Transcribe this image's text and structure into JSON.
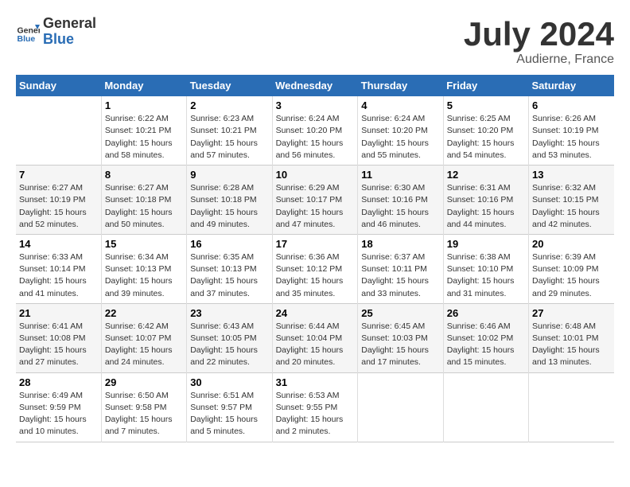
{
  "logo": {
    "text_general": "General",
    "text_blue": "Blue"
  },
  "title": "July 2024",
  "subtitle": "Audierne, France",
  "days_of_week": [
    "Sunday",
    "Monday",
    "Tuesday",
    "Wednesday",
    "Thursday",
    "Friday",
    "Saturday"
  ],
  "weeks": [
    [
      {
        "day": "",
        "sunrise": "",
        "sunset": "",
        "daylight": ""
      },
      {
        "day": "1",
        "sunrise": "Sunrise: 6:22 AM",
        "sunset": "Sunset: 10:21 PM",
        "daylight": "Daylight: 15 hours and 58 minutes."
      },
      {
        "day": "2",
        "sunrise": "Sunrise: 6:23 AM",
        "sunset": "Sunset: 10:21 PM",
        "daylight": "Daylight: 15 hours and 57 minutes."
      },
      {
        "day": "3",
        "sunrise": "Sunrise: 6:24 AM",
        "sunset": "Sunset: 10:20 PM",
        "daylight": "Daylight: 15 hours and 56 minutes."
      },
      {
        "day": "4",
        "sunrise": "Sunrise: 6:24 AM",
        "sunset": "Sunset: 10:20 PM",
        "daylight": "Daylight: 15 hours and 55 minutes."
      },
      {
        "day": "5",
        "sunrise": "Sunrise: 6:25 AM",
        "sunset": "Sunset: 10:20 PM",
        "daylight": "Daylight: 15 hours and 54 minutes."
      },
      {
        "day": "6",
        "sunrise": "Sunrise: 6:26 AM",
        "sunset": "Sunset: 10:19 PM",
        "daylight": "Daylight: 15 hours and 53 minutes."
      }
    ],
    [
      {
        "day": "7",
        "sunrise": "Sunrise: 6:27 AM",
        "sunset": "Sunset: 10:19 PM",
        "daylight": "Daylight: 15 hours and 52 minutes."
      },
      {
        "day": "8",
        "sunrise": "Sunrise: 6:27 AM",
        "sunset": "Sunset: 10:18 PM",
        "daylight": "Daylight: 15 hours and 50 minutes."
      },
      {
        "day": "9",
        "sunrise": "Sunrise: 6:28 AM",
        "sunset": "Sunset: 10:18 PM",
        "daylight": "Daylight: 15 hours and 49 minutes."
      },
      {
        "day": "10",
        "sunrise": "Sunrise: 6:29 AM",
        "sunset": "Sunset: 10:17 PM",
        "daylight": "Daylight: 15 hours and 47 minutes."
      },
      {
        "day": "11",
        "sunrise": "Sunrise: 6:30 AM",
        "sunset": "Sunset: 10:16 PM",
        "daylight": "Daylight: 15 hours and 46 minutes."
      },
      {
        "day": "12",
        "sunrise": "Sunrise: 6:31 AM",
        "sunset": "Sunset: 10:16 PM",
        "daylight": "Daylight: 15 hours and 44 minutes."
      },
      {
        "day": "13",
        "sunrise": "Sunrise: 6:32 AM",
        "sunset": "Sunset: 10:15 PM",
        "daylight": "Daylight: 15 hours and 42 minutes."
      }
    ],
    [
      {
        "day": "14",
        "sunrise": "Sunrise: 6:33 AM",
        "sunset": "Sunset: 10:14 PM",
        "daylight": "Daylight: 15 hours and 41 minutes."
      },
      {
        "day": "15",
        "sunrise": "Sunrise: 6:34 AM",
        "sunset": "Sunset: 10:13 PM",
        "daylight": "Daylight: 15 hours and 39 minutes."
      },
      {
        "day": "16",
        "sunrise": "Sunrise: 6:35 AM",
        "sunset": "Sunset: 10:13 PM",
        "daylight": "Daylight: 15 hours and 37 minutes."
      },
      {
        "day": "17",
        "sunrise": "Sunrise: 6:36 AM",
        "sunset": "Sunset: 10:12 PM",
        "daylight": "Daylight: 15 hours and 35 minutes."
      },
      {
        "day": "18",
        "sunrise": "Sunrise: 6:37 AM",
        "sunset": "Sunset: 10:11 PM",
        "daylight": "Daylight: 15 hours and 33 minutes."
      },
      {
        "day": "19",
        "sunrise": "Sunrise: 6:38 AM",
        "sunset": "Sunset: 10:10 PM",
        "daylight": "Daylight: 15 hours and 31 minutes."
      },
      {
        "day": "20",
        "sunrise": "Sunrise: 6:39 AM",
        "sunset": "Sunset: 10:09 PM",
        "daylight": "Daylight: 15 hours and 29 minutes."
      }
    ],
    [
      {
        "day": "21",
        "sunrise": "Sunrise: 6:41 AM",
        "sunset": "Sunset: 10:08 PM",
        "daylight": "Daylight: 15 hours and 27 minutes."
      },
      {
        "day": "22",
        "sunrise": "Sunrise: 6:42 AM",
        "sunset": "Sunset: 10:07 PM",
        "daylight": "Daylight: 15 hours and 24 minutes."
      },
      {
        "day": "23",
        "sunrise": "Sunrise: 6:43 AM",
        "sunset": "Sunset: 10:05 PM",
        "daylight": "Daylight: 15 hours and 22 minutes."
      },
      {
        "day": "24",
        "sunrise": "Sunrise: 6:44 AM",
        "sunset": "Sunset: 10:04 PM",
        "daylight": "Daylight: 15 hours and 20 minutes."
      },
      {
        "day": "25",
        "sunrise": "Sunrise: 6:45 AM",
        "sunset": "Sunset: 10:03 PM",
        "daylight": "Daylight: 15 hours and 17 minutes."
      },
      {
        "day": "26",
        "sunrise": "Sunrise: 6:46 AM",
        "sunset": "Sunset: 10:02 PM",
        "daylight": "Daylight: 15 hours and 15 minutes."
      },
      {
        "day": "27",
        "sunrise": "Sunrise: 6:48 AM",
        "sunset": "Sunset: 10:01 PM",
        "daylight": "Daylight: 15 hours and 13 minutes."
      }
    ],
    [
      {
        "day": "28",
        "sunrise": "Sunrise: 6:49 AM",
        "sunset": "Sunset: 9:59 PM",
        "daylight": "Daylight: 15 hours and 10 minutes."
      },
      {
        "day": "29",
        "sunrise": "Sunrise: 6:50 AM",
        "sunset": "Sunset: 9:58 PM",
        "daylight": "Daylight: 15 hours and 7 minutes."
      },
      {
        "day": "30",
        "sunrise": "Sunrise: 6:51 AM",
        "sunset": "Sunset: 9:57 PM",
        "daylight": "Daylight: 15 hours and 5 minutes."
      },
      {
        "day": "31",
        "sunrise": "Sunrise: 6:53 AM",
        "sunset": "Sunset: 9:55 PM",
        "daylight": "Daylight: 15 hours and 2 minutes."
      },
      {
        "day": "",
        "sunrise": "",
        "sunset": "",
        "daylight": ""
      },
      {
        "day": "",
        "sunrise": "",
        "sunset": "",
        "daylight": ""
      },
      {
        "day": "",
        "sunrise": "",
        "sunset": "",
        "daylight": ""
      }
    ]
  ]
}
